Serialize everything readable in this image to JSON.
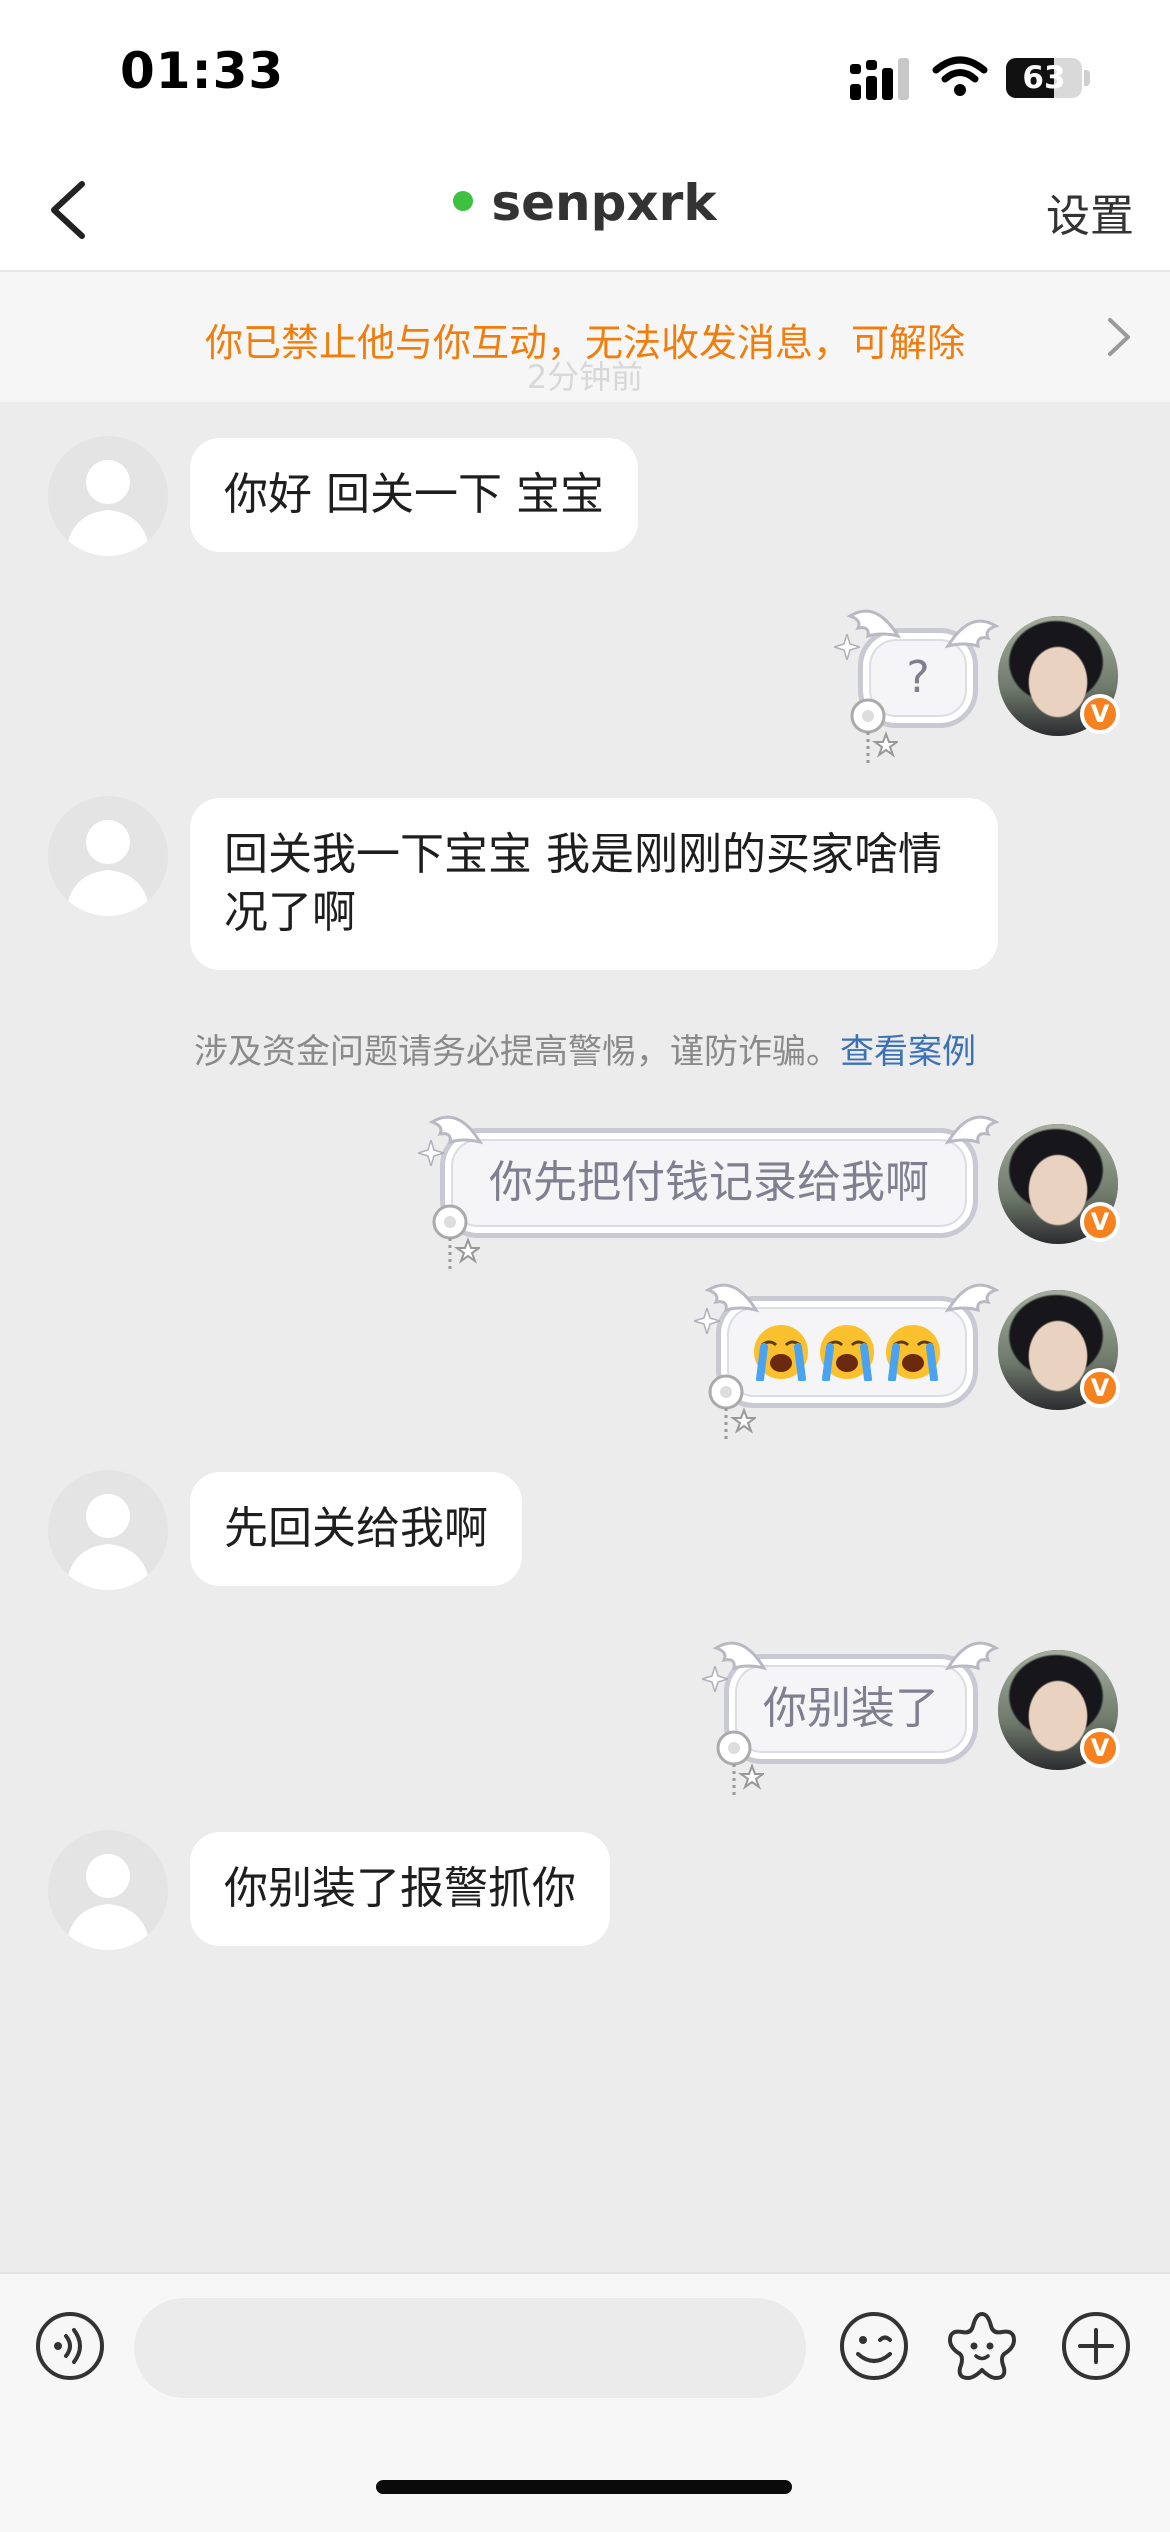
{
  "status_bar": {
    "time": "01:33",
    "battery": "63",
    "battery_level": 0.63
  },
  "header": {
    "contact_name": "senpxrk",
    "settings_label": "设置",
    "online": true
  },
  "banner": {
    "text": "你已禁止他与你互动，无法收发消息，可解除",
    "faint_timestamp": "2分钟前"
  },
  "messages": [
    {
      "side": "in",
      "text": "你好  回关一下 宝宝"
    },
    {
      "side": "out",
      "text": "?"
    },
    {
      "side": "in",
      "text": "回关我一下宝宝 我是刚刚的买家啥情况了啊"
    },
    {
      "side": "out",
      "text": "你先把付钱记录给我啊"
    },
    {
      "side": "out",
      "emoji": [
        "loudly-crying-face",
        "loudly-crying-face",
        "loudly-crying-face"
      ]
    },
    {
      "side": "in",
      "text": "先回关给我啊"
    },
    {
      "side": "out",
      "text": "你别装了"
    },
    {
      "side": "in",
      "text": "你别装了报警抓你"
    }
  ],
  "user_badge": "V",
  "safety_notice": {
    "text": "涉及资金问题请务必提高警惕，谨防诈骗。",
    "link": "查看案例"
  },
  "input": {
    "placeholder": ""
  },
  "colors": {
    "banner_text": "#f07d0c",
    "online_dot": "#3ec13e",
    "link": "#3c72b5",
    "badge": "#f6821f",
    "page_bg": "#ececec"
  }
}
